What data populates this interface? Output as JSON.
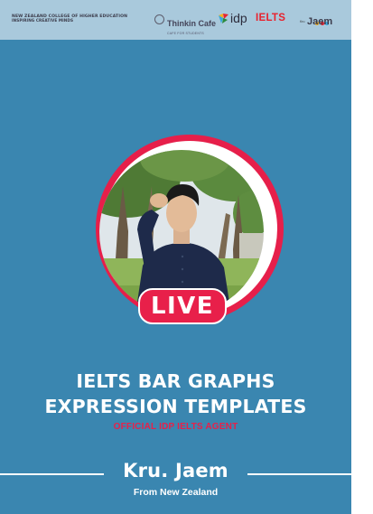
{
  "header": {
    "college_line1": "NEW ZEALAND COLLEGE OF HIGHER EDUCATION",
    "college_line2": "INSPIRING CREATIVE MINDS",
    "thinkin_name": "Thinkin Cafe",
    "thinkin_tagline": "CAFE FOR STUDENTS",
    "idp_text": "idp",
    "ielts_text": "IELTS",
    "krujaem_small": "Kru",
    "krujaem_text": "Jaem"
  },
  "badge": {
    "live_label": "LIVE"
  },
  "content": {
    "title_line1": "IELTS BAR GRAPHS",
    "title_line2": "EXPRESSION TEMPLATES",
    "subtitle": "OFFICIAL IDP IELTS AGENT",
    "presenter": "Kru. Jaem",
    "origin": "From New Zealand"
  },
  "colors": {
    "background": "#3a86b0",
    "topbar": "#a9c9dc",
    "accent_red": "#e8204a",
    "text": "#ffffff"
  },
  "icons": [
    "thinkin-cafe-logo-icon",
    "idp-logo-icon",
    "krujaem-dots-icon",
    "presenter-photo"
  ]
}
